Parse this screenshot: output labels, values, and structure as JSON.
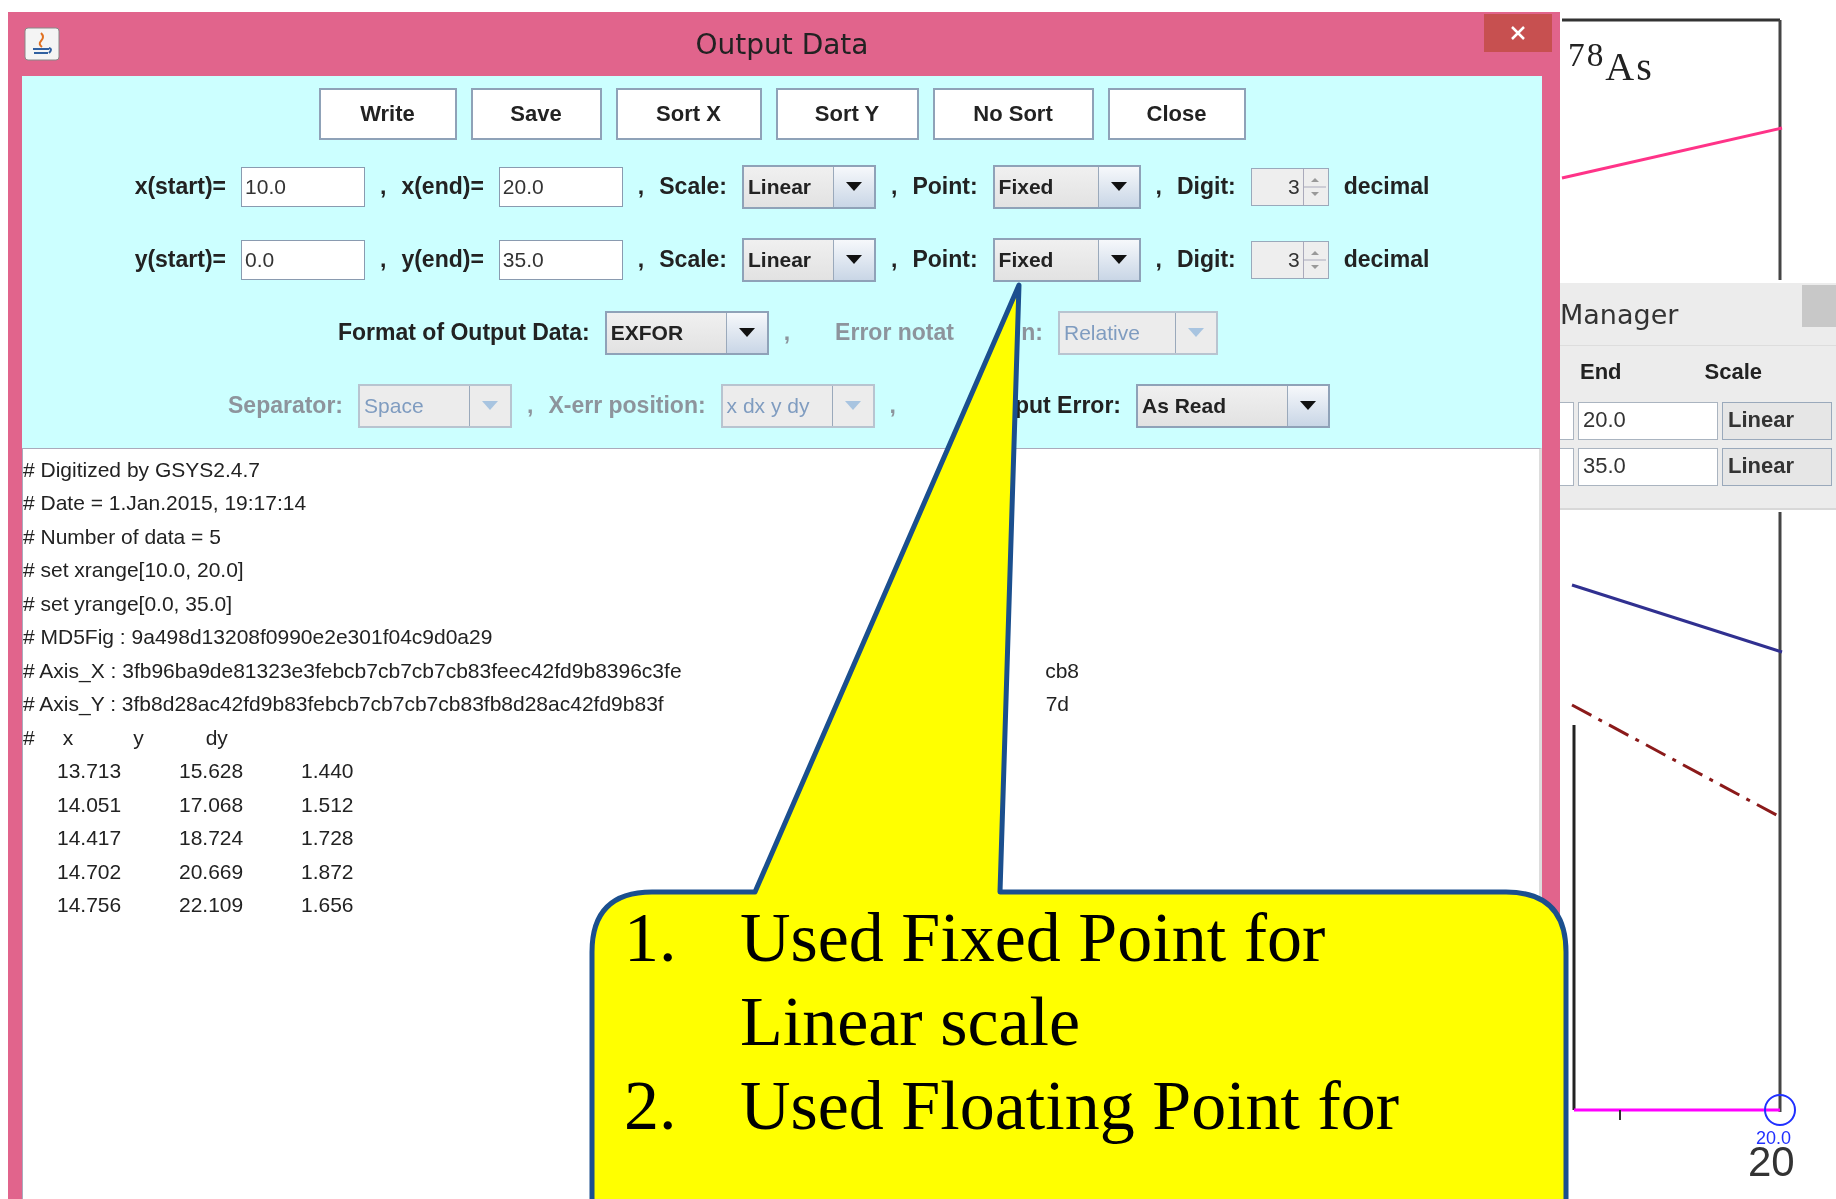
{
  "background_plot": {
    "label": "$^{78}$As",
    "tick_marker_label": "20.0",
    "tick_label": "20"
  },
  "manager_window": {
    "title": "Manager",
    "columns": [
      "End",
      "Scale"
    ],
    "rows": [
      {
        "end": "20.0",
        "scale": "Linear"
      },
      {
        "end": "35.0",
        "scale": "Linear"
      }
    ]
  },
  "window": {
    "title": "Output Data"
  },
  "buttons": [
    "Write",
    "Save",
    "Sort X",
    "Sort Y",
    "No Sort",
    "Close"
  ],
  "axis_rows": [
    {
      "comma": ",",
      "start_label": "x(start)=",
      "start": "10.0",
      "end_label": "x(end)=",
      "end": "20.0",
      "scale_label": "Scale:",
      "scale": "Linear",
      "point_label": "Point:",
      "point": "Fixed",
      "digit_label": "Digit:",
      "digit": "3",
      "unit": "decimal"
    },
    {
      "comma": ",",
      "start_label": "y(start)=",
      "start": "0.0",
      "end_label": "y(end)=",
      "end": "35.0",
      "scale_label": "Scale:",
      "scale": "Linear",
      "point_label": "Point:",
      "point": "Fixed",
      "digit_label": "Digit:",
      "digit": "3",
      "unit": "decimal"
    }
  ],
  "format_row": {
    "comma": ",",
    "label": "Format of Output Data:",
    "value": "EXFOR",
    "error_label": "Error notat",
    "error_label_tail": "n:",
    "error_value": "Relative",
    "error_disabled": true
  },
  "option_row": {
    "comma": ",",
    "separator_label": "Separator:",
    "separator": "Space",
    "separator_disabled": true,
    "xerr_label": "X-err position:",
    "xerr": "x dx y dy",
    "xerr_disabled": true,
    "input_error_label": "put Error:",
    "input_error": "As Read",
    "input_error_disabled": false
  },
  "output_lines": [
    {
      "text": "# Digitized by GSYS2.4.7"
    },
    {
      "text": "# Date =  1.Jan.2015,  19:17:14"
    },
    {
      "text": "# Number of data = 5"
    },
    {
      "text": "# set xrange[10.0, 20.0]"
    },
    {
      "text": "# set yrange[0.0, 35.0]"
    },
    {
      "text": "# MD5Fig : 9a498d13208f0990e2e301f04c9d0a29"
    },
    {
      "text": "# Axis_X : 3fb96ba9de81323e3febcb7cb7cb7cb83feec42fd9b8396c3fe",
      "tail": "cb8"
    },
    {
      "text": "# Axis_Y : 3fb8d28ac42fd9b83febcb7cb7cb7cb83fb8d28ac42fd9b83f",
      "tail": "7d"
    }
  ],
  "output_table": {
    "header": [
      "#",
      "x",
      "y",
      "dy"
    ],
    "rows": [
      [
        "13.713",
        "15.628",
        "1.440"
      ],
      [
        "14.051",
        "17.068",
        "1.512"
      ],
      [
        "14.417",
        "18.724",
        "1.728"
      ],
      [
        "14.702",
        "20.669",
        "1.872"
      ],
      [
        "14.756",
        "22.109",
        "1.656"
      ]
    ]
  },
  "callout": {
    "items": [
      {
        "number": "1.",
        "text": "Used Fixed Point for Linear scale"
      },
      {
        "number": "2.",
        "text": "Used Floating Point for"
      }
    ]
  }
}
